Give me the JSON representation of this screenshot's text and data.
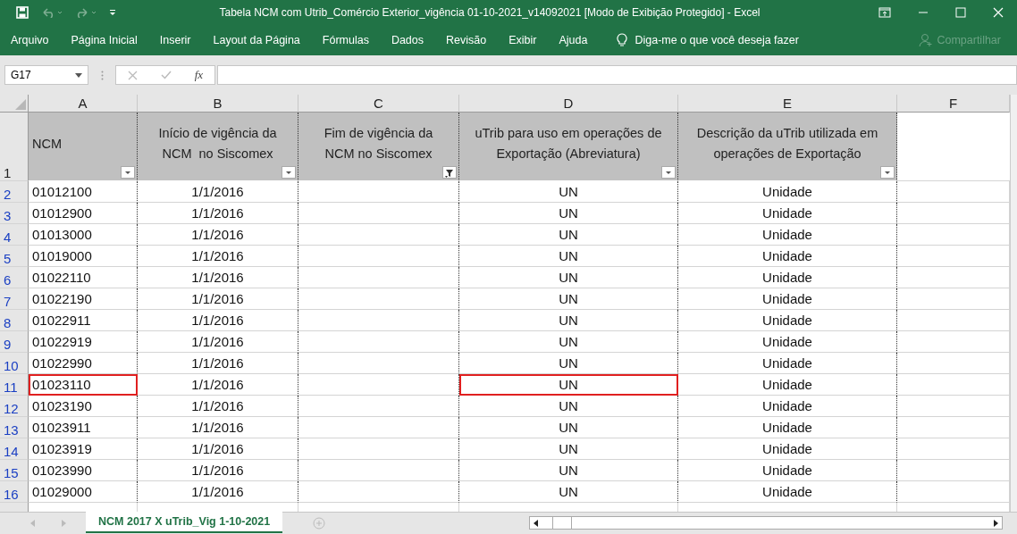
{
  "window": {
    "title": "Tabela NCM com Utrib_Comércio Exterior_vigência 01-10-2021_v14092021  [Modo de Exibição Protegido]  -  Excel"
  },
  "ribbon_tabs": [
    "Arquivo",
    "Página Inicial",
    "Inserir",
    "Layout da Página",
    "Fórmulas",
    "Dados",
    "Revisão",
    "Exibir",
    "Ajuda"
  ],
  "tell_me": "Diga-me o que você deseja fazer",
  "share": "Compartilhar",
  "name_box": "G17",
  "formula_symbol": "fx",
  "column_letters": [
    "A",
    "B",
    "C",
    "D",
    "E",
    "F"
  ],
  "header_row": {
    "row": "1",
    "cells": [
      {
        "text": "NCM",
        "filtered": false
      },
      {
        "text": "Início de vigência da NCM  no Siscomex",
        "filtered": false
      },
      {
        "text": "Fim de vigência da NCM no Siscomex",
        "filtered": true
      },
      {
        "text": "uTrib para uso em operações de Exportação (Abreviatura)",
        "filtered": false
      },
      {
        "text": "Descrição da uTrib utilizada em operações de Exportação",
        "filtered": false
      }
    ]
  },
  "rows": [
    {
      "row": "2",
      "ncm": "01012100",
      "start": "1/1/2016",
      "utrib": "UN",
      "description": "Unidade",
      "ncm_marked": false,
      "utrib_marked": false
    },
    {
      "row": "3",
      "ncm": "01012900",
      "start": "1/1/2016",
      "utrib": "UN",
      "description": "Unidade",
      "ncm_marked": false,
      "utrib_marked": false
    },
    {
      "row": "4",
      "ncm": "01013000",
      "start": "1/1/2016",
      "utrib": "UN",
      "description": "Unidade",
      "ncm_marked": false,
      "utrib_marked": false
    },
    {
      "row": "5",
      "ncm": "01019000",
      "start": "1/1/2016",
      "utrib": "UN",
      "description": "Unidade",
      "ncm_marked": false,
      "utrib_marked": false
    },
    {
      "row": "6",
      "ncm": "01022110",
      "start": "1/1/2016",
      "utrib": "UN",
      "description": "Unidade",
      "ncm_marked": false,
      "utrib_marked": false
    },
    {
      "row": "7",
      "ncm": "01022190",
      "start": "1/1/2016",
      "utrib": "UN",
      "description": "Unidade",
      "ncm_marked": false,
      "utrib_marked": false
    },
    {
      "row": "8",
      "ncm": "01022911",
      "start": "1/1/2016",
      "utrib": "UN",
      "description": "Unidade",
      "ncm_marked": false,
      "utrib_marked": false
    },
    {
      "row": "9",
      "ncm": "01022919",
      "start": "1/1/2016",
      "utrib": "UN",
      "description": "Unidade",
      "ncm_marked": false,
      "utrib_marked": false
    },
    {
      "row": "10",
      "ncm": "01022990",
      "start": "1/1/2016",
      "utrib": "UN",
      "description": "Unidade",
      "ncm_marked": false,
      "utrib_marked": false
    },
    {
      "row": "11",
      "ncm": "01023110",
      "start": "1/1/2016",
      "utrib": "UN",
      "description": "Unidade",
      "ncm_marked": true,
      "utrib_marked": true
    },
    {
      "row": "12",
      "ncm": "01023190",
      "start": "1/1/2016",
      "utrib": "UN",
      "description": "Unidade",
      "ncm_marked": false,
      "utrib_marked": false
    },
    {
      "row": "13",
      "ncm": "01023911",
      "start": "1/1/2016",
      "utrib": "UN",
      "description": "Unidade",
      "ncm_marked": false,
      "utrib_marked": false
    },
    {
      "row": "14",
      "ncm": "01023919",
      "start": "1/1/2016",
      "utrib": "UN",
      "description": "Unidade",
      "ncm_marked": false,
      "utrib_marked": false
    },
    {
      "row": "15",
      "ncm": "01023990",
      "start": "1/1/2016",
      "utrib": "UN",
      "description": "Unidade",
      "ncm_marked": false,
      "utrib_marked": false
    },
    {
      "row": "16",
      "ncm": "01029000",
      "start": "1/1/2016",
      "utrib": "UN",
      "description": "Unidade",
      "ncm_marked": false,
      "utrib_marked": false
    }
  ],
  "sheet_tabs": [
    {
      "label": "NCM 2017 X uTrib_Vig 1-10-2021",
      "selected": true
    }
  ]
}
